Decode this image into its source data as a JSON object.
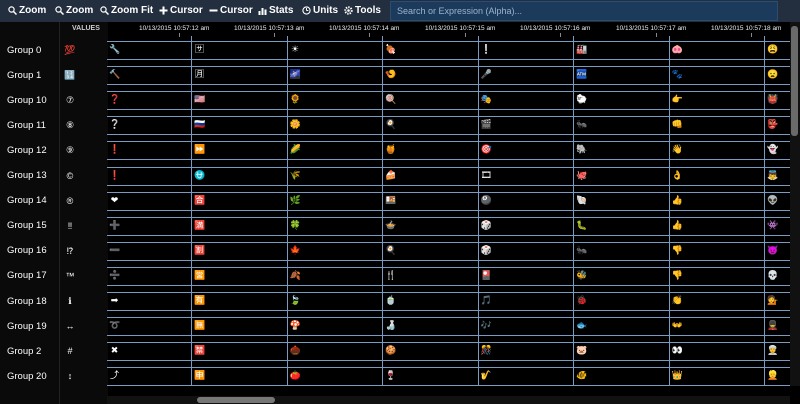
{
  "toolbar": {
    "buttons": [
      {
        "label": "Zoom",
        "icon": "zoom-in-icon"
      },
      {
        "label": "Zoom",
        "icon": "zoom-out-icon"
      },
      {
        "label": "Zoom Fit",
        "icon": "zoom-fit-icon"
      },
      {
        "label": "Cursor",
        "icon": "plus-icon"
      },
      {
        "label": "Cursor",
        "icon": "minus-icon"
      },
      {
        "label": "Stats",
        "icon": "bar-chart-icon"
      },
      {
        "label": "Units",
        "icon": "clock-icon"
      },
      {
        "label": "Tools",
        "icon": "gear-icon"
      }
    ],
    "search_placeholder": "Search or Expression (Alpha)..."
  },
  "values_header": "VALUES",
  "time_ticks": [
    "10/13/2015 10:57:12 am",
    "10/13/2015 10:57:13 am",
    "10/13/2015 10:57:14 am",
    "10/13/2015 10:57:15 am",
    "10/13/2015 10:57:16 am",
    "10/13/2015 10:57:17 am",
    "10/13/2015 10:57:18 am"
  ],
  "groups": [
    {
      "label": "Group 0",
      "value": "💯",
      "cells": [
        "🔧",
        "🈂",
        "☀",
        "🍖",
        "❕",
        "🏭",
        "🐽",
        "😩"
      ]
    },
    {
      "label": "Group 1",
      "value": "🔢",
      "cells": [
        "🔨",
        "🈷",
        "🌌",
        "🍤",
        "🎤",
        "🏧",
        "🐾",
        "😦"
      ]
    },
    {
      "label": "Group 10",
      "value": "⑦",
      "cells": [
        "❓",
        "🇺🇸",
        "🌻",
        "🍭",
        "🎭",
        "🐑",
        "👉",
        "👹"
      ]
    },
    {
      "label": "Group 11",
      "value": "⑧",
      "cells": [
        "❔",
        "🇷🇺",
        "🌼",
        "🍳",
        "🎬",
        "🐜",
        "👊",
        "👺"
      ]
    },
    {
      "label": "Group 12",
      "value": "⑨",
      "cells": [
        "❗",
        "⏩",
        "🌽",
        "🍯",
        "🎯",
        "🐘",
        "👋",
        "👻"
      ]
    },
    {
      "label": "Group 13",
      "value": "©",
      "cells": [
        "❗",
        "⛎",
        "🌾",
        "🍰",
        "🎞",
        "🐙",
        "👌",
        "👼"
      ]
    },
    {
      "label": "Group 14",
      "value": "®",
      "cells": [
        "❤",
        "🈴",
        "🌿",
        "🍱",
        "🎱",
        "🐚",
        "👍",
        "👽"
      ]
    },
    {
      "label": "Group 15",
      "value": "‼",
      "cells": [
        "➕",
        "🈵",
        "🍀",
        "🍲",
        "🎲",
        "🐛",
        "👍",
        "👾"
      ]
    },
    {
      "label": "Group 16",
      "value": "⁉",
      "cells": [
        "➖",
        "🈹",
        "🍁",
        "🍳",
        "🎲",
        "🐜",
        "👎",
        "👿"
      ]
    },
    {
      "label": "Group 17",
      "value": "™",
      "cells": [
        "➗",
        "🈺",
        "🍂",
        "🍴",
        "🎴",
        "🐝",
        "👎",
        "💀"
      ]
    },
    {
      "label": "Group 18",
      "value": "ℹ",
      "cells": [
        "➡",
        "🈶",
        "🍃",
        "🍵",
        "🎵",
        "🐞",
        "👏",
        "💁"
      ]
    },
    {
      "label": "Group 19",
      "value": "↔",
      "cells": [
        "➰",
        "🈚",
        "🍄",
        "🍶",
        "🎶",
        "🐟",
        "👐",
        "💂"
      ]
    },
    {
      "label": "Group 2",
      "value": "#",
      "cells": [
        "✖",
        "🈲",
        "🌰",
        "🍪",
        "🎊",
        "🐷",
        "👀",
        "👳"
      ]
    },
    {
      "label": "Group 20",
      "value": "↕",
      "cells": [
        "⤴",
        "🈸",
        "🍅",
        "🍷",
        "🎷",
        "🐠",
        "👑",
        "👱"
      ]
    }
  ]
}
